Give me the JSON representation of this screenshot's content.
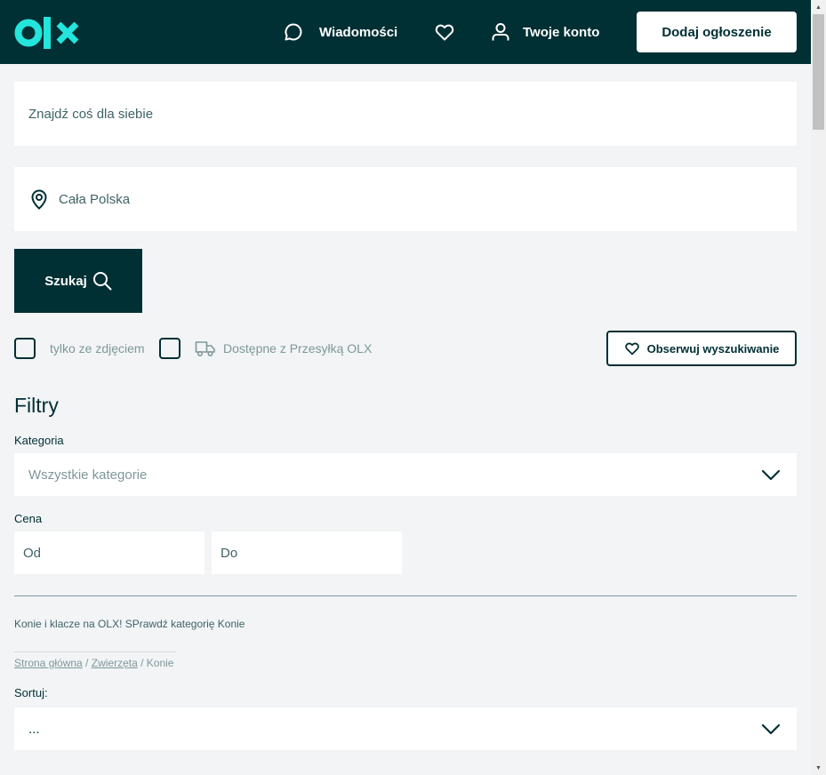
{
  "header": {
    "logo": "olx",
    "messages_label": "Wiadomości",
    "account_label": "Twoje konto",
    "post_button": "Dodaj ogłoszenie"
  },
  "search": {
    "placeholder": "Znajdź coś dla siebie",
    "location": "Cała Polska",
    "button": "Szukaj"
  },
  "options": {
    "with_photo": "tylko ze zdjęciem",
    "olx_delivery": "Dostępne z Przesyłką OLX",
    "observe_button": "Obserwuj wyszukiwanie"
  },
  "filters": {
    "title": "Filtry",
    "category_label": "Kategoria",
    "category_value": "Wszystkie kategorie",
    "price_label": "Cena",
    "price_from": "Od",
    "price_to": "Do"
  },
  "promo_text": "Konie i klacze na OLX! SPrawdź kategorię Konie",
  "breadcrumb": {
    "home": "Strona główna",
    "sep1": " / ",
    "animals": "Zwierzęta",
    "sep2": " / ",
    "current": "Konie"
  },
  "sort": {
    "label": "Sortuj:",
    "value": "..."
  },
  "colors": {
    "brand_dark": "#002f34",
    "brand_accent": "#23e5db",
    "page_bg": "#f2f4f5"
  }
}
